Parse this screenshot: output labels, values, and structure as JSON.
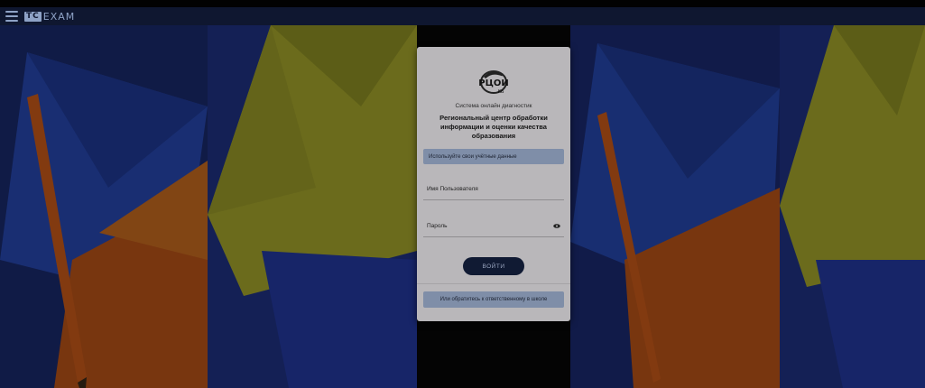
{
  "header": {
    "logo_tc": "TC",
    "logo_exam": "EXAM",
    "menu_icon": "hamburger-menu-icon"
  },
  "login": {
    "logo_icon": "rcoi-logo",
    "subtitle": "Система онлайн диагностик",
    "title": "Региональный центр обработки информации и оценки качества образования",
    "info_text": "Используйте свои учётные данные",
    "username_label": "Имя Пользователя",
    "password_label": "Пароль",
    "password_toggle_icon": "eye-icon",
    "login_button": "ВОЙТИ",
    "contact_text": "Или обратитесь к ответственному в школе"
  },
  "colors": {
    "header_bg": "#0f1730",
    "card_bg": "#b9b7ba",
    "button_bg": "#101a33",
    "info_bg": "#7f8ea8"
  }
}
